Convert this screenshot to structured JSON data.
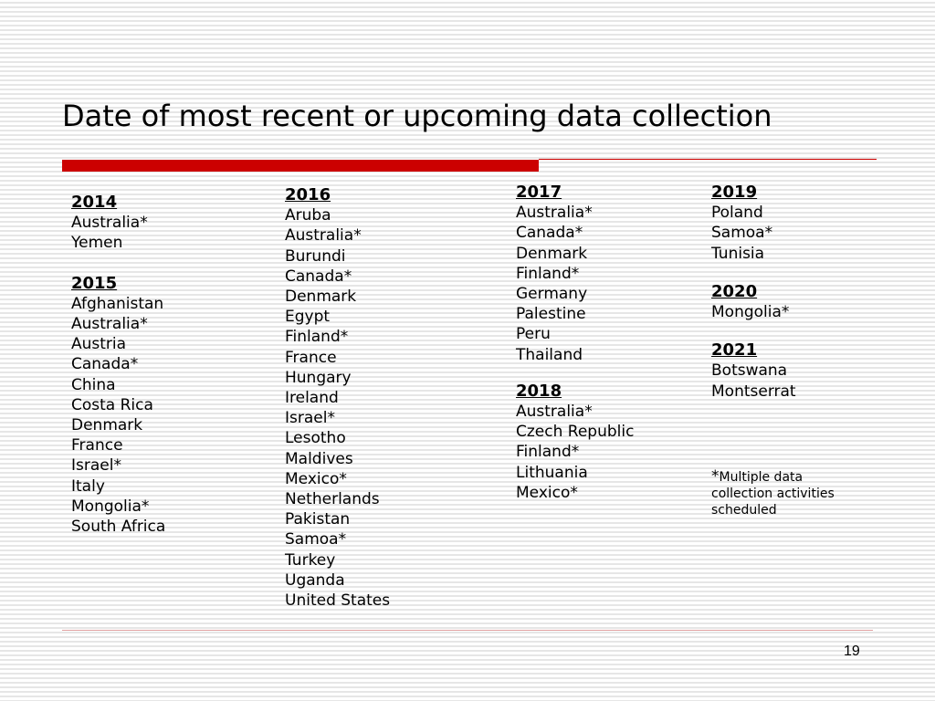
{
  "slide": {
    "title": "Date of most recent or upcoming data collection",
    "page_number": "19",
    "accent_color": "#cc0000",
    "footnote_star": "*",
    "footnote_text": "Multiple data collection activities scheduled"
  },
  "columns": [
    {
      "groups": [
        {
          "year": "2014",
          "countries": [
            "Australia*",
            "Yemen"
          ]
        },
        {
          "year": "2015",
          "countries": [
            "Afghanistan",
            "Australia*",
            "Austria",
            "Canada*",
            "China",
            "Costa Rica",
            "Denmark",
            "France",
            "Israel*",
            "Italy",
            "Mongolia*",
            "South Africa"
          ]
        }
      ]
    },
    {
      "groups": [
        {
          "year": "2016",
          "countries": [
            "Aruba",
            "Australia*",
            "Burundi",
            "Canada*",
            "Denmark",
            "Egypt",
            "Finland*",
            "France",
            "Hungary",
            "Ireland",
            "Israel*",
            "Lesotho",
            "Maldives",
            "Mexico*",
            "Netherlands",
            "Pakistan",
            "Samoa*",
            "Turkey",
            "Uganda",
            "United States"
          ]
        }
      ]
    },
    {
      "groups": [
        {
          "year": "2017",
          "countries": [
            "Australia*",
            "Canada*",
            "Denmark",
            "Finland*",
            "Germany",
            "Palestine",
            "Peru",
            "Thailand"
          ]
        },
        {
          "year": "2018",
          "countries": [
            "Australia*",
            "Czech Republic",
            "Finland*",
            "Lithuania",
            "Mexico*"
          ]
        }
      ]
    },
    {
      "groups": [
        {
          "year": "2019",
          "countries": [
            "Poland",
            "Samoa*",
            "Tunisia"
          ]
        },
        {
          "year": "2020",
          "countries": [
            "Mongolia*"
          ]
        },
        {
          "year": "2021",
          "countries": [
            "Botswana",
            "Montserrat"
          ]
        }
      ]
    }
  ]
}
